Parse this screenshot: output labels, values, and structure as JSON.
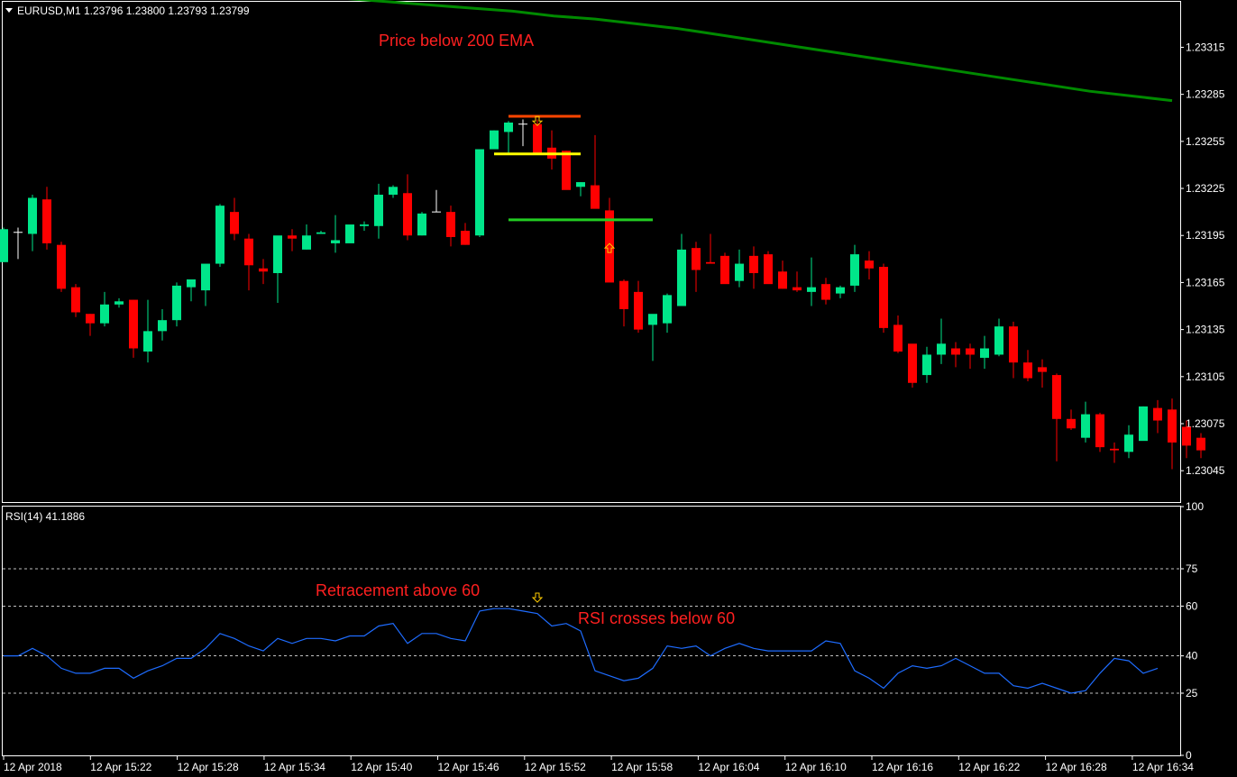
{
  "header": {
    "symbol": "EURUSD,M1",
    "quote": "1.23796 1.23800 1.23793 1.23799",
    "menu_icon": "triangle-down-icon"
  },
  "rsi_header": {
    "label": "RSI(14) 41.1886"
  },
  "annotations": {
    "ema": "Price below 200 EMA",
    "retracement": "Retracement above 60",
    "rsi_cross": "RSI crosses below 60"
  },
  "colors": {
    "bull": "#00e68a",
    "bear": "#ff0000",
    "doji": "#ffffff",
    "ema": "#008a00",
    "rsi": "#1e6cff",
    "grid_border": "#ffffff",
    "annotation": "#ff2020",
    "entry_line": "#ffff00",
    "stop_line": "#ff4500",
    "target_line": "#22cc22",
    "arrow": "#ffcc00"
  },
  "chart_data": [
    {
      "type": "candlestick",
      "title": "",
      "price_ticks": [
        "1.23315",
        "1.23285",
        "1.23255",
        "1.23225",
        "1.23195",
        "1.23165",
        "1.23135",
        "1.23105",
        "1.23075",
        "1.23045"
      ],
      "price_range": [
        1.23025,
        1.23344
      ],
      "time_labels": [
        "12 Apr 2018",
        "12 Apr 15:22",
        "12 Apr 15:28",
        "12 Apr 15:34",
        "12 Apr 15:40",
        "12 Apr 15:46",
        "12 Apr 15:52",
        "12 Apr 15:58",
        "12 Apr 16:04",
        "12 Apr 16:10",
        "12 Apr 16:16",
        "12 Apr 16:22",
        "12 Apr 16:28",
        "12 Apr 16:34"
      ],
      "candles": [
        [
          1.23178,
          1.232,
          1.23178,
          1.23199
        ],
        [
          1.23197,
          1.232,
          1.2318,
          1.23197
        ],
        [
          1.23196,
          1.23221,
          1.23185,
          1.23219
        ],
        [
          1.23218,
          1.23226,
          1.23186,
          1.2319
        ],
        [
          1.23189,
          1.23191,
          1.23159,
          1.23161
        ],
        [
          1.23162,
          1.23164,
          1.23143,
          1.23146
        ],
        [
          1.23145,
          1.23145,
          1.23131,
          1.23139
        ],
        [
          1.23139,
          1.23159,
          1.23137,
          1.23151
        ],
        [
          1.23151,
          1.23155,
          1.23149,
          1.23153
        ],
        [
          1.23154,
          1.23154,
          1.23117,
          1.23123
        ],
        [
          1.23121,
          1.23154,
          1.23114,
          1.23134
        ],
        [
          1.23134,
          1.23148,
          1.23128,
          1.23141
        ],
        [
          1.23141,
          1.23165,
          1.23137,
          1.23163
        ],
        [
          1.23162,
          1.23167,
          1.23153,
          1.23167
        ],
        [
          1.2316,
          1.2317,
          1.2315,
          1.23177
        ],
        [
          1.23177,
          1.23215,
          1.23175,
          1.23214
        ],
        [
          1.2321,
          1.23219,
          1.23192,
          1.23196
        ],
        [
          1.23193,
          1.23196,
          1.2316,
          1.23176
        ],
        [
          1.23174,
          1.2318,
          1.23164,
          1.23172
        ],
        [
          1.23171,
          1.2319,
          1.23152,
          1.23195
        ],
        [
          1.23195,
          1.23199,
          1.23185,
          1.23193
        ],
        [
          1.23186,
          1.23202,
          1.23186,
          1.23195
        ],
        [
          1.23196,
          1.23198,
          1.23196,
          1.23197
        ],
        [
          1.2319,
          1.23208,
          1.23184,
          1.23192
        ],
        [
          1.2319,
          1.2319,
          1.2319,
          1.23202
        ],
        [
          1.23201,
          1.23204,
          1.23198,
          1.23202
        ],
        [
          1.23201,
          1.23228,
          1.23193,
          1.23221
        ],
        [
          1.23221,
          1.23227,
          1.23219,
          1.23226
        ],
        [
          1.23222,
          1.23234,
          1.23192,
          1.23195
        ],
        [
          1.23195,
          1.2321,
          1.23195,
          1.23209
        ],
        [
          1.2321,
          1.23224,
          1.2321,
          1.2321
        ],
        [
          1.2321,
          1.23214,
          1.23188,
          1.23194
        ],
        [
          1.23198,
          1.23203,
          1.23189,
          1.23189
        ],
        [
          1.23195,
          1.23194,
          1.23195,
          1.2325
        ],
        [
          1.2325,
          1.23262,
          1.2325,
          1.23262
        ],
        [
          1.23261,
          1.23268,
          1.23247,
          1.23267
        ],
        [
          1.23266,
          1.23269,
          1.23252,
          1.23266
        ],
        [
          1.23266,
          1.23269,
          1.23251,
          1.23247
        ],
        [
          1.23251,
          1.23262,
          1.23237,
          1.23244
        ],
        [
          1.23249,
          1.23249,
          1.23225,
          1.23224
        ],
        [
          1.23226,
          1.23229,
          1.2322,
          1.23229
        ],
        [
          1.23227,
          1.23259,
          1.23213,
          1.23212
        ],
        [
          1.23211,
          1.23219,
          1.23166,
          1.23165
        ],
        [
          1.23166,
          1.23167,
          1.23137,
          1.23148
        ],
        [
          1.23159,
          1.23166,
          1.23133,
          1.23135
        ],
        [
          1.23138,
          1.23143,
          1.23115,
          1.23145
        ],
        [
          1.23139,
          1.23158,
          1.23133,
          1.23157
        ],
        [
          1.2315,
          1.23196,
          1.2315,
          1.23186
        ],
        [
          1.23187,
          1.23191,
          1.23159,
          1.23173
        ],
        [
          1.23178,
          1.23196,
          1.23177,
          1.23177
        ],
        [
          1.23182,
          1.23184,
          1.23165,
          1.23164
        ],
        [
          1.23166,
          1.23186,
          1.23162,
          1.23177
        ],
        [
          1.23182,
          1.23188,
          1.23161,
          1.23171
        ],
        [
          1.23183,
          1.23185,
          1.23166,
          1.23164
        ],
        [
          1.23172,
          1.23179,
          1.23161,
          1.23161
        ],
        [
          1.23162,
          1.23172,
          1.23159,
          1.2316
        ],
        [
          1.23159,
          1.23181,
          1.2315,
          1.23162
        ],
        [
          1.23164,
          1.23168,
          1.23151,
          1.23154
        ],
        [
          1.23158,
          1.23163,
          1.23155,
          1.23162
        ],
        [
          1.23163,
          1.23189,
          1.23159,
          1.23183
        ],
        [
          1.23179,
          1.23185,
          1.23167,
          1.23174
        ],
        [
          1.23175,
          1.23177,
          1.23133,
          1.23136
        ],
        [
          1.23138,
          1.23144,
          1.2312,
          1.23121
        ],
        [
          1.23126,
          1.23125,
          1.23098,
          1.23101
        ],
        [
          1.23106,
          1.23124,
          1.23101,
          1.23119
        ],
        [
          1.23119,
          1.23142,
          1.23113,
          1.23126
        ],
        [
          1.23123,
          1.23127,
          1.23111,
          1.23119
        ],
        [
          1.23123,
          1.23126,
          1.2311,
          1.23119
        ],
        [
          1.23117,
          1.23131,
          1.2311,
          1.23123
        ],
        [
          1.23119,
          1.23142,
          1.23118,
          1.23137
        ],
        [
          1.23137,
          1.2314,
          1.23104,
          1.23114
        ],
        [
          1.23114,
          1.23122,
          1.23102,
          1.23104
        ],
        [
          1.23111,
          1.23116,
          1.23098,
          1.23108
        ],
        [
          1.23106,
          1.23107,
          1.23051,
          1.23078
        ],
        [
          1.23078,
          1.23084,
          1.23071,
          1.23072
        ],
        [
          1.23066,
          1.23089,
          1.23063,
          1.23081
        ],
        [
          1.23081,
          1.23082,
          1.23057,
          1.2306
        ],
        [
          1.23059,
          1.23063,
          1.2305,
          1.23058
        ],
        [
          1.23057,
          1.23074,
          1.23053,
          1.23068
        ],
        [
          1.23064,
          1.23086,
          1.23065,
          1.23086
        ],
        [
          1.23085,
          1.2309,
          1.23069,
          1.23077
        ],
        [
          1.23084,
          1.23091,
          1.23046,
          1.23063
        ],
        [
          1.23073,
          1.23077,
          1.23053,
          1.23061
        ],
        [
          1.23066,
          1.23069,
          1.23053,
          1.23058
        ]
      ],
      "ema_200": [
        1.23347,
        1.23346,
        1.23344,
        1.23342,
        1.2334,
        1.23338,
        1.23335,
        1.23333,
        1.2333,
        1.23327,
        1.23323,
        1.23319,
        1.23315,
        1.23311,
        1.23307,
        1.23303,
        1.23299,
        1.23295,
        1.23291,
        1.23287,
        1.23284,
        1.23281
      ],
      "levels": [
        {
          "name": "stop",
          "price": 1.23271,
          "from_bar": 35,
          "to_bar": 40
        },
        {
          "name": "entry",
          "price": 1.23247,
          "from_bar": 34,
          "to_bar": 40
        },
        {
          "name": "target",
          "price": 1.23205,
          "from_bar": 35,
          "to_bar": 45
        }
      ],
      "signals": [
        {
          "type": "sell-arrow",
          "bar": 37,
          "price": 1.23268
        },
        {
          "type": "buy-arrow",
          "bar": 42,
          "price": 1.23187
        }
      ]
    },
    {
      "type": "line",
      "title": "RSI(14) 41.1886",
      "ylim": [
        0,
        100
      ],
      "y_ticks": [
        "100",
        "75",
        "60",
        "40",
        "25",
        "0"
      ],
      "levels": [
        75,
        60,
        40,
        25
      ],
      "series": [
        {
          "values": [
            40,
            40,
            43,
            40,
            35,
            33,
            33,
            35,
            35,
            31,
            34,
            36,
            39,
            39,
            43,
            49,
            47,
            44,
            42,
            47,
            45,
            47,
            47,
            46,
            48,
            48,
            52,
            53,
            45,
            49,
            49,
            47,
            46,
            58,
            59,
            59,
            58,
            57,
            52,
            53,
            50,
            34,
            32,
            30,
            31,
            35,
            44,
            43,
            44,
            40,
            43,
            45,
            43,
            42,
            42,
            42,
            42,
            46,
            45,
            34,
            31,
            27,
            33,
            36,
            35,
            36,
            39,
            36,
            33,
            33,
            28,
            27,
            29,
            27,
            25,
            26,
            33,
            39,
            38,
            33,
            35
          ]
        }
      ],
      "signals": [
        {
          "type": "sell-arrow",
          "index": 37
        }
      ]
    }
  ]
}
